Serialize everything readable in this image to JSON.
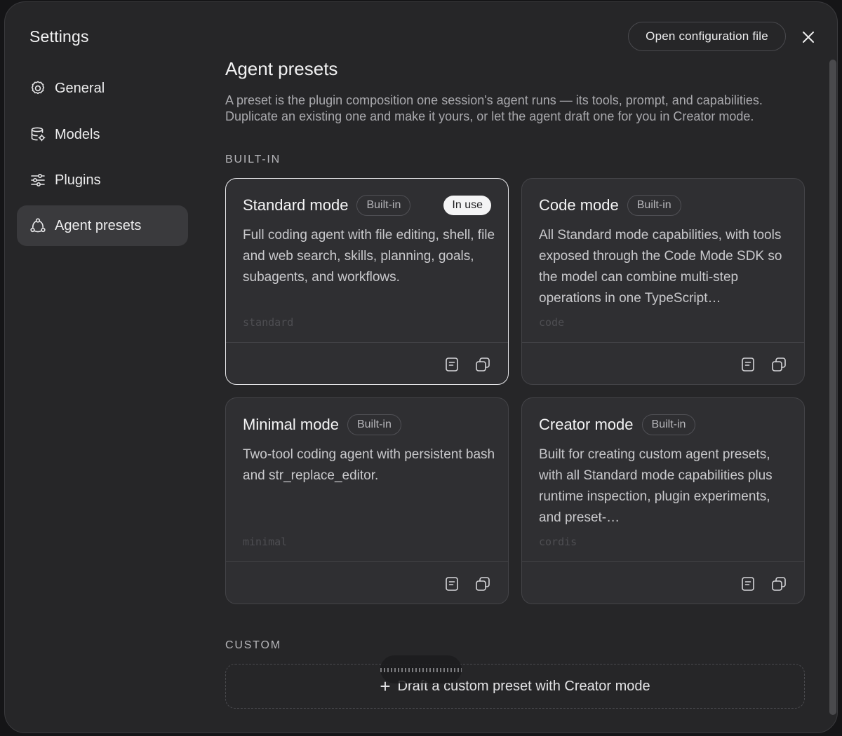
{
  "sidebar": {
    "title": "Settings",
    "items": [
      {
        "label": "General",
        "icon": "gear-icon"
      },
      {
        "label": "Models",
        "icon": "database-icon"
      },
      {
        "label": "Plugins",
        "icon": "sliders-icon"
      },
      {
        "label": "Agent presets",
        "icon": "presets-icon",
        "active": true
      }
    ]
  },
  "header": {
    "open_config_label": "Open configuration file",
    "close_icon": "close-icon"
  },
  "main": {
    "title": "Agent presets",
    "description": "A preset is the plugin composition one session's agent runs — its tools, prompt, and capabilities. Duplicate an existing one and make it yours, or let the agent draft one for you in Creator mode.",
    "builtin_label": "BUILT-IN",
    "custom_label": "CUSTOM",
    "presets": [
      {
        "name": "Standard mode",
        "badge": "Built-in",
        "status": "In use",
        "description": "Full coding agent with file editing, shell, file and web search, skills, planning, goals, subagents, and workflows.",
        "slug": "standard"
      },
      {
        "name": "Code mode",
        "badge": "Built-in",
        "description": "All Standard mode capabilities, with tools exposed through the Code Mode SDK so the model can combine multi-step operations in one TypeScript…",
        "slug": "code"
      },
      {
        "name": "Minimal mode",
        "badge": "Built-in",
        "description": "Two-tool coding agent with persistent bash and str_replace_editor.",
        "slug": "minimal"
      },
      {
        "name": "Creator mode",
        "badge": "Built-in",
        "description": "Built for creating custom agent presets, with all Standard mode capabilities plus runtime inspection, plugin experiments, and preset-…",
        "slug": "cordis"
      }
    ],
    "draft_label": "Draft a custom preset with Creator mode"
  }
}
